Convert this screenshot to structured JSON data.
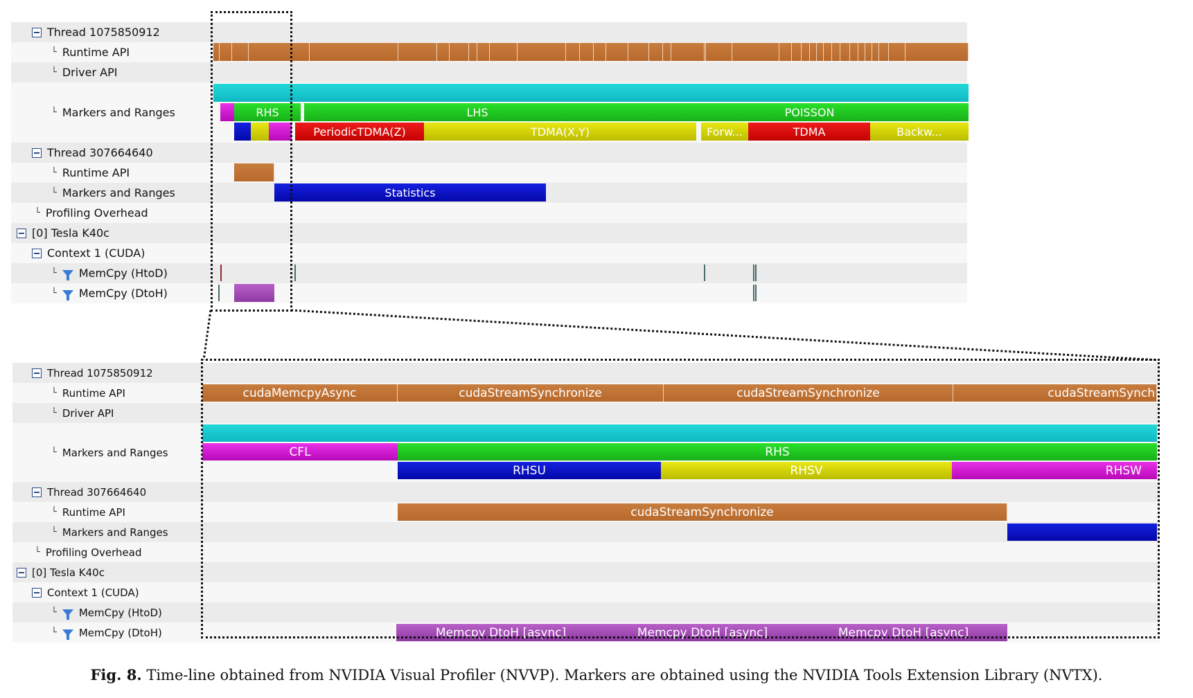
{
  "top": {
    "thread1": {
      "label": "Thread 1075850912",
      "runtime_api": "Runtime API",
      "driver_api": "Driver API",
      "markers_ranges": "Markers and Ranges",
      "range_rhs": "RHS",
      "range_lhs": "LHS",
      "range_poisson": "POISSON",
      "range_periodic_tdma": "PeriodicTDMA(Z)",
      "range_tdma_xy": "TDMA(X,Y)",
      "range_forw": "Forw...",
      "range_tdma": "TDMA",
      "range_backw": "Backw..."
    },
    "thread2": {
      "label": "Thread 307664640",
      "runtime_api": "Runtime API",
      "markers_ranges": "Markers and Ranges",
      "range_statistics": "Statistics"
    },
    "profiling_overhead": "Profiling Overhead",
    "device": "[0] Tesla K40c",
    "context": "Context 1 (CUDA)",
    "memcpy_htod": "MemCpy (HtoD)",
    "memcpy_dtoh": "MemCpy (DtoH)"
  },
  "bottom": {
    "thread1": {
      "label": "Thread 1075850912",
      "runtime_api": "Runtime API",
      "driver_api": "Driver API",
      "markers_ranges": "Markers and Ranges",
      "api_1": "cudaMemcpyAsync",
      "api_2": "cudaStreamSynchronize",
      "api_3": "cudaStreamSynchronize",
      "api_4": "cudaStreamSynch",
      "range_cfl": "CFL",
      "range_rhs": "RHS",
      "range_rhsu": "RHSU",
      "range_rhsv": "RHSV",
      "range_rhsw": "RHSW"
    },
    "thread2": {
      "label": "Thread 307664640",
      "runtime_api": "Runtime API",
      "markers_ranges": "Markers and Ranges",
      "api_1": "cudaStreamSynchronize"
    },
    "profiling_overhead": "Profiling Overhead",
    "device": "[0] Tesla K40c",
    "context": "Context 1 (CUDA)",
    "memcpy_htod": "MemCpy (HtoD)",
    "memcpy_dtoh": "MemCpy (DtoH)",
    "dtoh_1": "Memcpy DtoH [async]",
    "dtoh_2": "Memcpy DtoH [async]",
    "dtoh_3": "Memcpy DtoH [async]"
  },
  "caption": {
    "fig": "Fig. 8.",
    "text": "Time-line obtained from NVIDIA Visual Profiler (NVVP). Markers are obtained using the NVIDIA Tools Extension Library (NVTX)."
  },
  "colors": {
    "runtime_api": "#c0752f",
    "markers_cyan": "#16c6cc",
    "range_green": "#22cc22",
    "range_magenta": "#d020d0",
    "range_yellow": "#d4d400",
    "range_red": "#dd0a0a",
    "range_blue": "#0c12c8",
    "memcpy_purple": "#a24db6"
  }
}
